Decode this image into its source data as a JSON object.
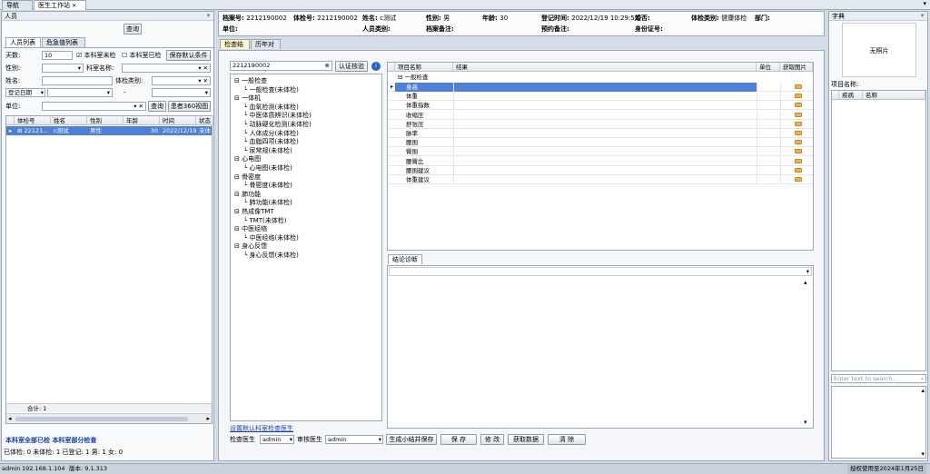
{
  "tabs": [
    {
      "label": "导航"
    },
    {
      "label": "医生工作站",
      "close": "✕"
    }
  ],
  "left_panel": {
    "title": "人员",
    "query_btn": "查询",
    "subtabs": [
      "人员列表",
      "危急值列表"
    ],
    "days_label": "天数:",
    "days_value": "10",
    "cb_unchecked_label": "本科室未检",
    "cb_checked_label": "本科室已检",
    "save_default": "保存默认条件",
    "gender_label": "性别:",
    "dept_name_label": "科室名称:",
    "name_label": "姓名:",
    "exam_type_label": "体检类别:",
    "reg_date_label": "登记日期",
    "range_sep": "-",
    "unit_label": "单位:",
    "query_btn2": "查询",
    "view360": "患者360视图",
    "columns": [
      "体检号",
      "姓名",
      "性别",
      "年龄",
      "时间",
      "状态"
    ],
    "rows": [
      {
        "id": "22121...",
        "name": "c测试",
        "gender": "男性",
        "age": "30",
        "time": "2022/12/19",
        "status": "未体"
      }
    ],
    "total": "合计: 1",
    "legend_all": "本科室全部已检",
    "legend_part": "本科室部分检查",
    "stats": "已体检: 0    未体检: 1    已登记: 1    男: 1 女: 0"
  },
  "header": {
    "file_no_label": "档案号:",
    "file_no": "2212190002",
    "exam_no_label": "体检号:",
    "exam_no": "2212190002",
    "name_label": "姓名:",
    "name": "c测试",
    "gender_label": "性别:",
    "gender": "男",
    "age_label": "年龄:",
    "age": "30",
    "reg_time_label": "登记时间:",
    "reg_time": "2022/12/19 10:29:55",
    "marriage_label": "婚否:",
    "exam_type_label": "体检类别:",
    "exam_type": "健康体检",
    "dept_label": "部门:",
    "unit_label": "单位:",
    "person_type_label": "人员类别:",
    "file_note_label": "档案备注:",
    "appointment_note_label": "预约备注:",
    "id_no_label": "身份证号:"
  },
  "center": {
    "tabs": [
      "检查结果",
      "历年对比"
    ],
    "search_value": "2212190002",
    "verify_btn": "认证核验",
    "tree": [
      {
        "label": "一般检查",
        "level": 0
      },
      {
        "label": "一般检查(未体检)",
        "level": 1
      },
      {
        "label": "一体机",
        "level": 0
      },
      {
        "label": "血氧检测(未体检)",
        "level": 1
      },
      {
        "label": "中医体质辨识(未体检)",
        "level": 1
      },
      {
        "label": "动脉硬化检测(未体检)",
        "level": 1
      },
      {
        "label": "人体成分(未体检)",
        "level": 1
      },
      {
        "label": "血脂四项(未体检)",
        "level": 1
      },
      {
        "label": "尿常规(未体检)",
        "level": 1
      },
      {
        "label": "心电图",
        "level": 0
      },
      {
        "label": "心电图(未体检)",
        "level": 1
      },
      {
        "label": "骨密度",
        "level": 0
      },
      {
        "label": "骨密度(未体检)",
        "level": 1
      },
      {
        "label": "肺功能",
        "level": 0
      },
      {
        "label": "肺功能(未体检)",
        "level": 1
      },
      {
        "label": "热成像TMT",
        "level": 0
      },
      {
        "label": "TMT(未体检)",
        "level": 1
      },
      {
        "label": "中医经络",
        "level": 0
      },
      {
        "label": "中医经络(未体检)",
        "level": 1
      },
      {
        "label": "身心反馈",
        "level": 0
      },
      {
        "label": "身心反馈(未体检)",
        "level": 1
      }
    ],
    "set_default_doctor": "设置默认科室检查医生",
    "exam_doctor_label": "检查医生",
    "exam_doctor": "admin",
    "review_doctor_label": "审核医生",
    "review_doctor": "admin",
    "buttons": [
      "生成小结并保存",
      "保 存",
      "修 改",
      "获取数据",
      "清 除"
    ]
  },
  "results": {
    "columns": [
      "项目名称",
      "结果",
      "单位",
      "获取图片"
    ],
    "group": "一般检查",
    "items": [
      "身高",
      "体重",
      "体重指数",
      "收缩压",
      "舒张压",
      "脉率",
      "腰围",
      "臀围",
      "腰臀比",
      "腰围建议",
      "体重建议"
    ]
  },
  "conclusion": {
    "tab": "结论诊断"
  },
  "right_panel": {
    "title": "字典",
    "no_photo": "无照片",
    "item_name_label": "项目名称:",
    "columns": [
      "疾病",
      "名称"
    ],
    "search_placeholder": "Enter text to search..."
  },
  "status": {
    "user": "admin",
    "ip": "192.168.1.104",
    "version": "版本: 9.1.313",
    "license": "授权使用至2024年1月25日"
  },
  "colors": {
    "selected": "#4f7fd6",
    "bg": "#d4dde7",
    "accent": "#1a3fa0"
  }
}
